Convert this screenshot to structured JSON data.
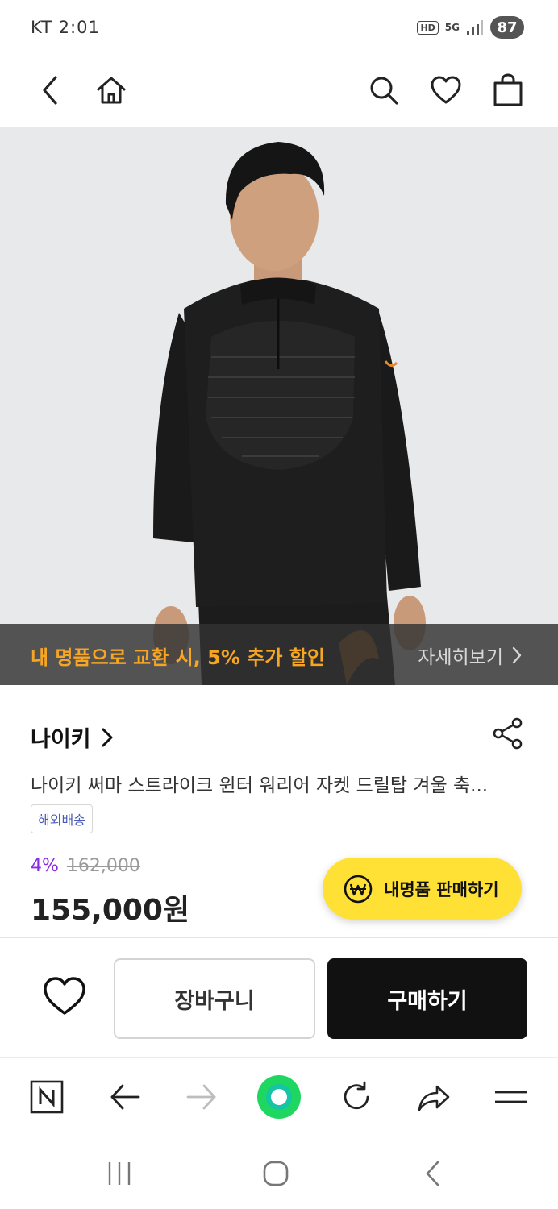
{
  "status_bar": {
    "carrier_time": "KT 2:01",
    "hd": "HD",
    "network": "5G",
    "battery": "87"
  },
  "header": {
    "icons": [
      "back-icon",
      "home-icon",
      "search-icon",
      "heart-icon",
      "shopping-bag-icon"
    ]
  },
  "promo": {
    "text": "내 명품으로 교환 시, 5% 추가 할인",
    "link_label": "자세히보기",
    "text_color": "#f7a623"
  },
  "product": {
    "brand": "나이키",
    "title": "나이키 써마 스트라이크 윈터 워리어 자켓 드릴탑 겨울 축...",
    "shipping_tag": "해외배송",
    "discount": "4%",
    "original_price": "162,000",
    "price": "155,000원"
  },
  "sell_button": {
    "label": "내명품 판매하기",
    "color": "#ffe135"
  },
  "actions": {
    "cart_label": "장바구니",
    "buy_label": "구매하기"
  },
  "browser_toolbar": {
    "items": [
      "naver-icon",
      "back-arrow-icon",
      "forward-arrow-icon",
      "green-dot-icon",
      "refresh-icon",
      "share-arrow-icon",
      "menu-icon"
    ],
    "accent": "#1ed760"
  },
  "nav_bar": {
    "items": [
      "recent-apps-icon",
      "home-circle-icon",
      "nav-back-icon"
    ]
  }
}
